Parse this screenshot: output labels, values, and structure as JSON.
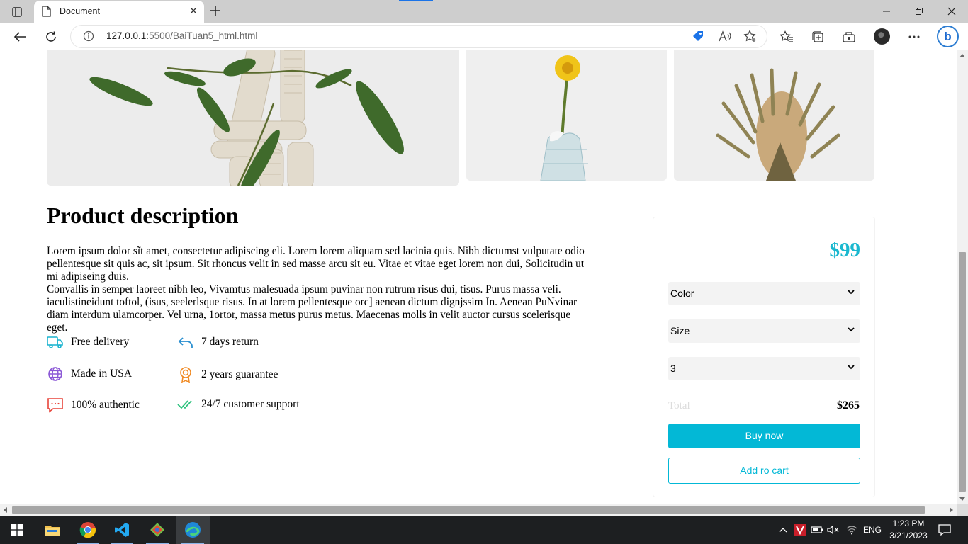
{
  "browser": {
    "tab_title": "Document",
    "url_host": "127.0.0.1",
    "url_rest": ":5500/BaiTuan5_html.html"
  },
  "page": {
    "description_title": "Product description",
    "description_p1": "Lorem ipsum dolor sĩt amet, consectetur adipiscing eli. Lorem lorem aliquam sed lacinia quis. Nibh dictumst vulputate odio pellentesque sit quis ac, sit ipsum. Sit rhoncus velit in sed masse arcu sit eu. Vitae et vitae eget lorem non dui, Solicitudin ut mi adipiseing duis.",
    "description_p2": "Convallis in semper laoreet nibh leo, Vivamtus malesuada ipsum puvinar non rutrum risus dui, tisus. Purus massa veli. iaculistineidunt toftol, (isus, seelerlsque risus. In at lorem pellentesque orc] aenean dictum dignjssim In. Aenean PuNvinar diam interdum ulamcorper. Vel urna, 1ortor, massa metus purus metus. Maecenas molls in velit auctor cursus scelerisque eget.",
    "features": [
      {
        "label": "Free delivery",
        "icon": "truck-icon"
      },
      {
        "label": "7 days return",
        "icon": "return-arrow-icon"
      },
      {
        "label": "Made in USA",
        "icon": "globe-icon"
      },
      {
        "label": "2 years guarantee",
        "icon": "award-icon"
      },
      {
        "label": "100% authentic",
        "icon": "message-alert-icon"
      },
      {
        "label": "24/7 customer support",
        "icon": "double-check-icon"
      }
    ]
  },
  "purchase": {
    "price": "$99",
    "color_select": "Color",
    "size_select": "Size",
    "quantity_select": "3",
    "total_label": "Total",
    "total_value": "$265",
    "buy_label": "Buy now",
    "cart_label": "Add ro cart"
  },
  "taskbar": {
    "lang": "ENG",
    "time": "1:23 PM",
    "date": "3/21/2023"
  },
  "colors": {
    "accent": "#03b8d6",
    "price": "#1ab8cf",
    "truck": "#19b3cf",
    "globe": "#8a56d6",
    "award": "#f08a24",
    "message": "#e8443a",
    "check": "#2ec27e"
  }
}
